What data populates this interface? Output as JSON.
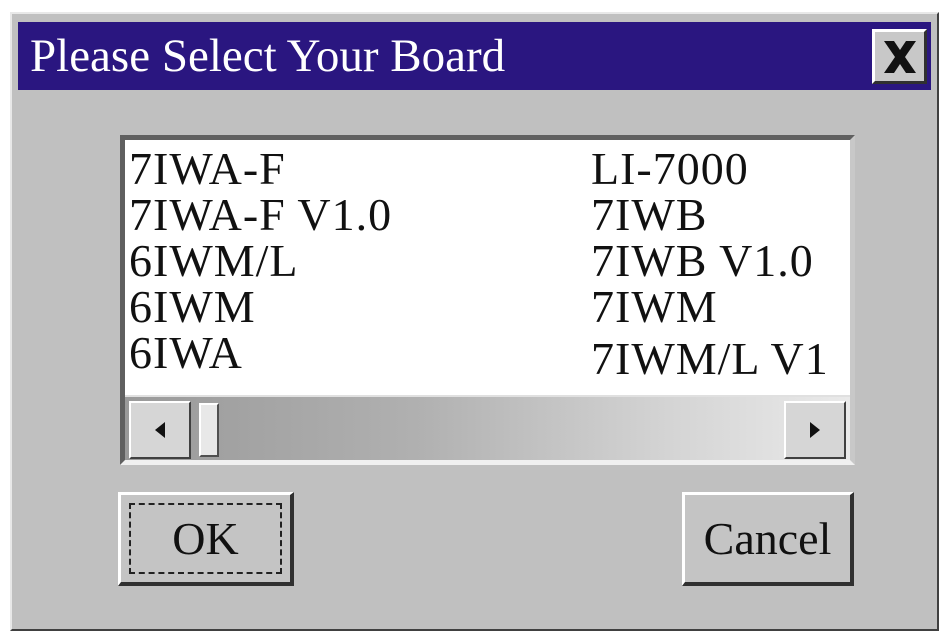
{
  "dialog": {
    "title": "Please Select Your Board",
    "close_label": "X"
  },
  "board_list": {
    "left_column": [
      "7IWA-F",
      "7IWA-F V1.0",
      "6IWM/L",
      "6IWM",
      "6IWA"
    ],
    "right_column": [
      "LI-7000",
      "7IWB",
      "7IWB V1.0",
      "7IWM",
      "7IWM/L V1"
    ]
  },
  "scrollbar": {
    "left_arrow_icon": "left-arrow-icon",
    "right_arrow_icon": "right-arrow-icon",
    "position": 0
  },
  "buttons": {
    "ok_label": "OK",
    "cancel_label": "Cancel"
  },
  "colors": {
    "titlebar": "#2a1680",
    "dialog_bg": "#c0c0c0"
  }
}
